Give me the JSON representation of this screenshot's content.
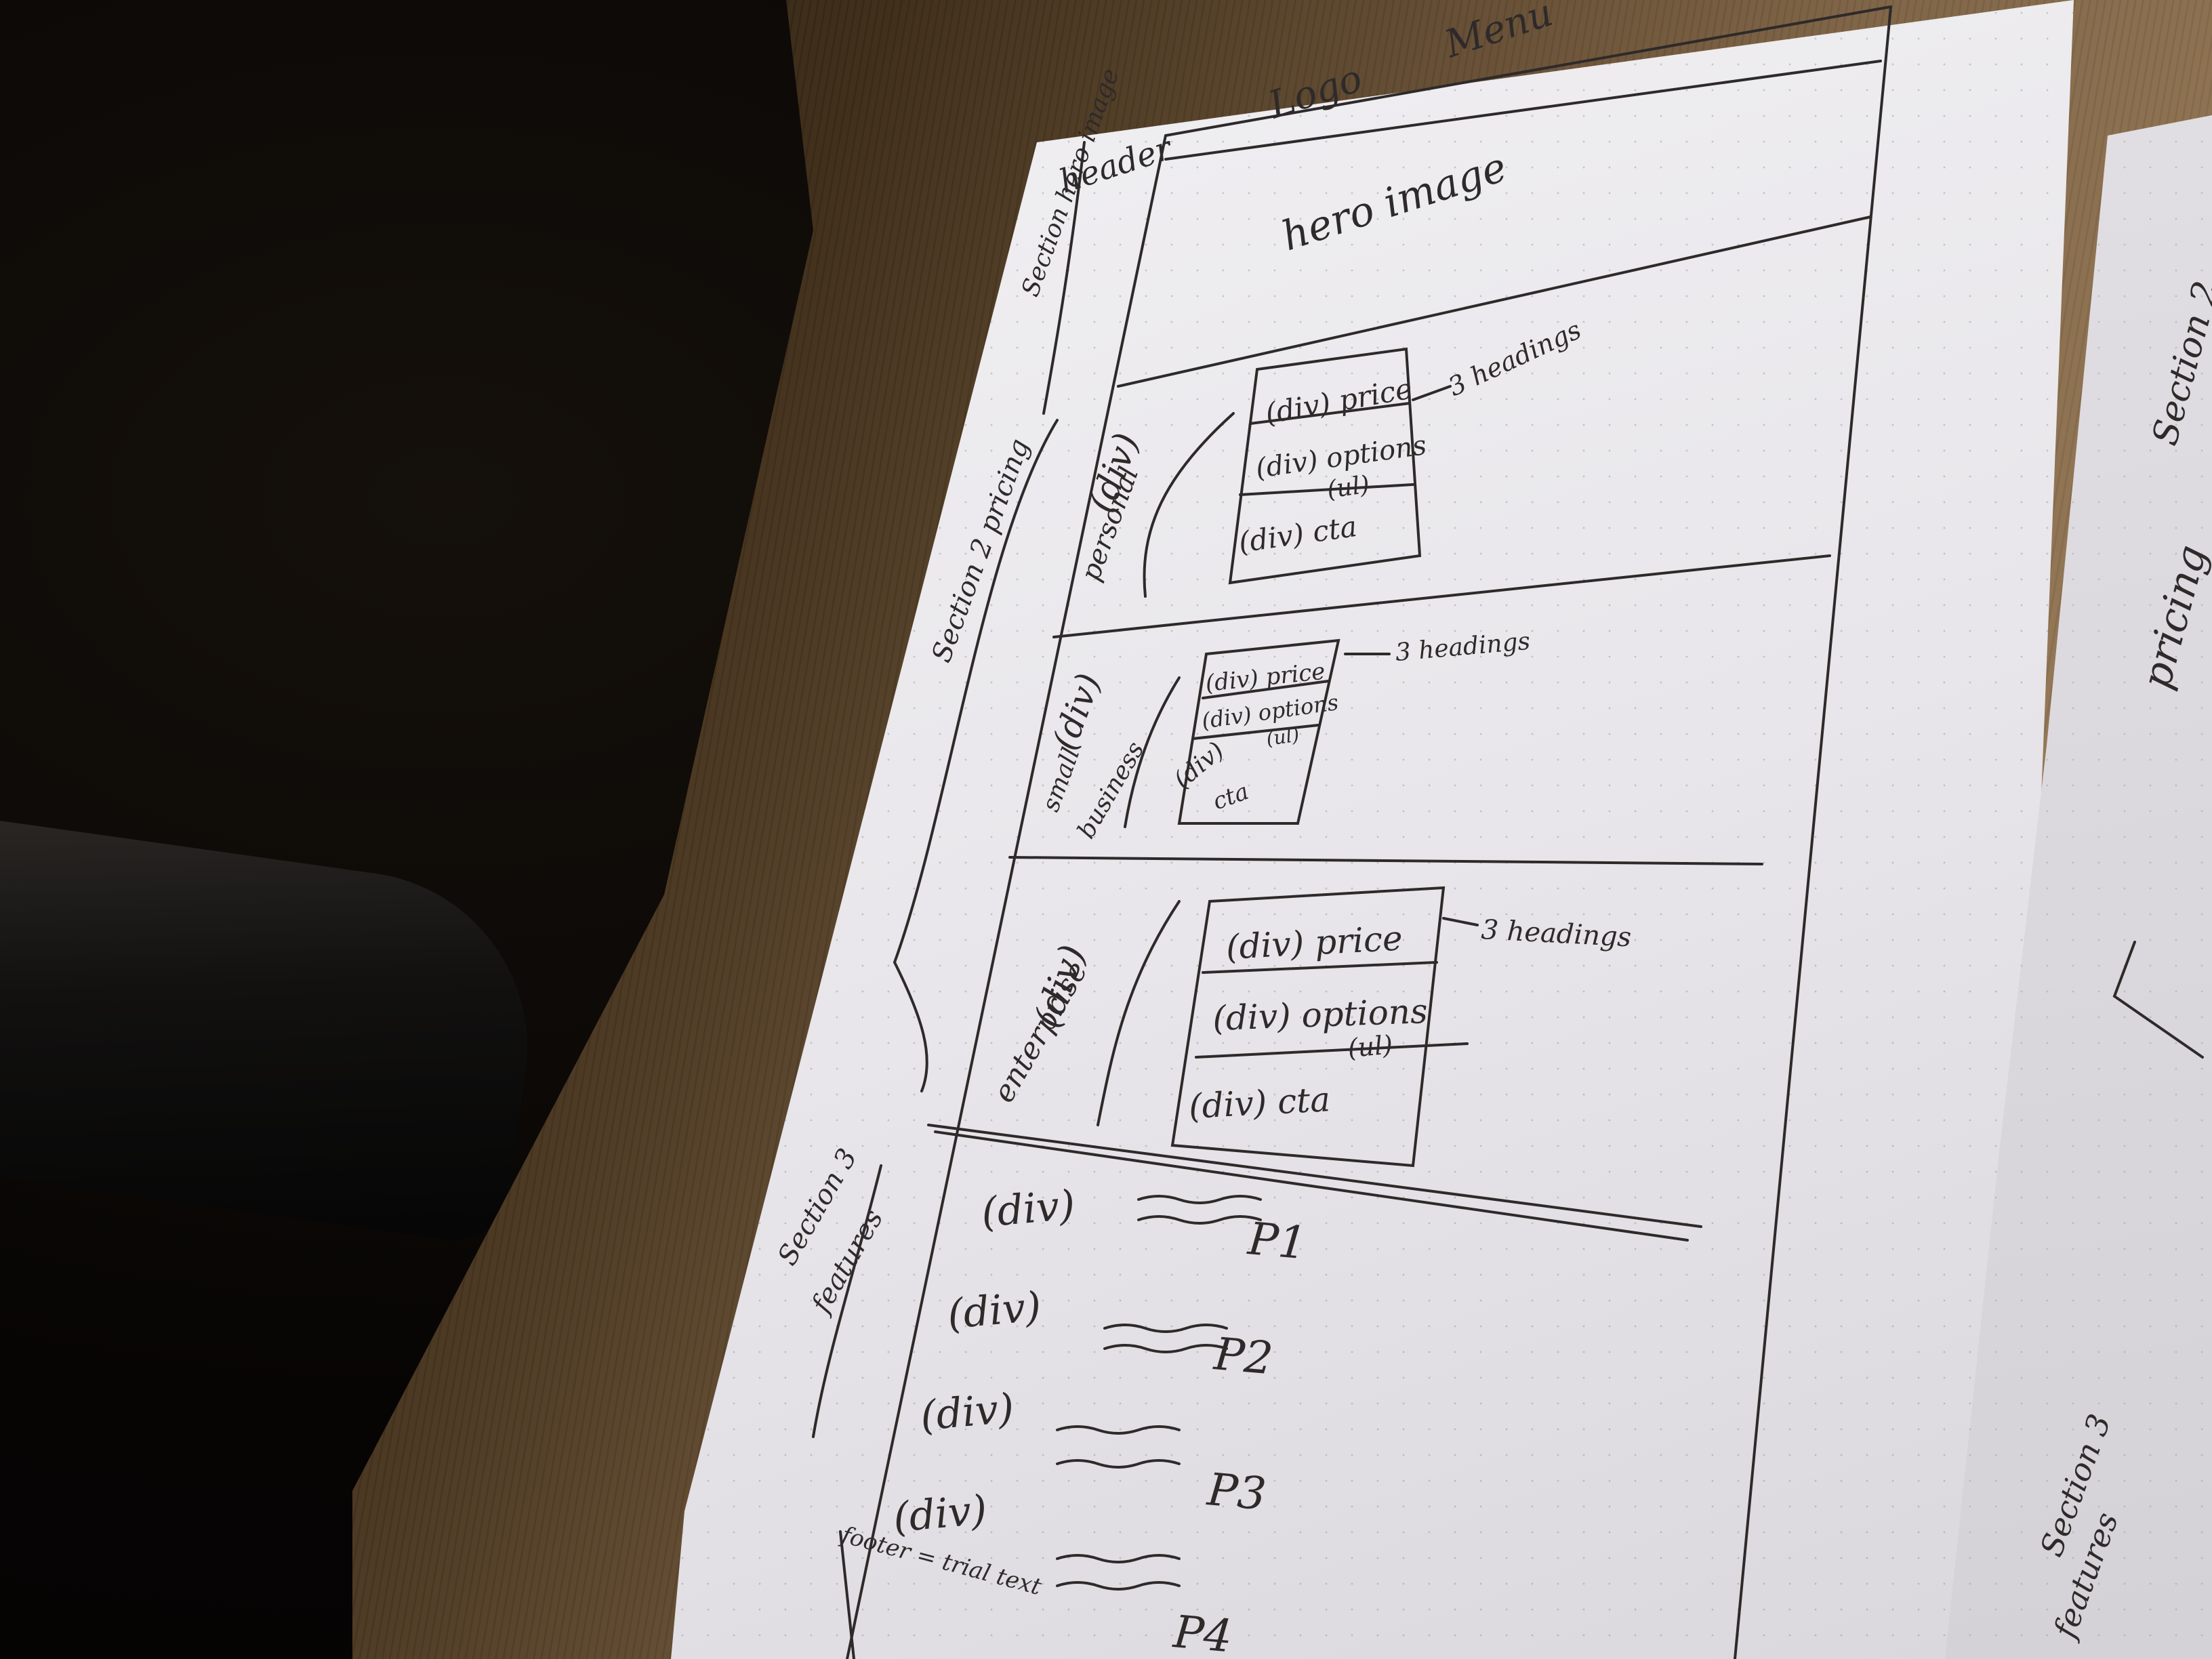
{
  "scene": {
    "description_kind": "photo",
    "ink_color": "#2e2a2a",
    "paper_color": "#ecebee",
    "table_color": "#7d6244"
  },
  "wireframe": {
    "header": "header",
    "logo": "Logo",
    "menu": "Menu",
    "hero_section_label": "Section hero image",
    "hero": "hero image",
    "pricing_section_label": "Section 2 pricing",
    "personal": {
      "div": "(div)",
      "name": "personal",
      "price": "(div) price",
      "options": "(div) options",
      "options_ul": "(ul)",
      "cta": "(div) cta",
      "note": "3 headings"
    },
    "small_business": {
      "div": "(div)",
      "name_1": "small",
      "name_2": "business",
      "price": "(div) price",
      "options": "(div) options",
      "options_ul": "(ul)",
      "cta_div": "(div)",
      "cta": "cta",
      "note": "3 headings"
    },
    "enterprise": {
      "div": "(div)",
      "name": "enterprise",
      "price": "(div) price",
      "options": "(div) options",
      "options_ul": "(ul)",
      "cta": "(div) cta",
      "note": "3 headings"
    },
    "features_section_label_1": "Section 3",
    "features_section_label_2": "features",
    "features": [
      {
        "div": "(div)",
        "p": "P1"
      },
      {
        "div": "(div)",
        "p": "P2"
      },
      {
        "div": "(div)",
        "p": "P3"
      },
      {
        "div": "(div)",
        "p": "P4"
      }
    ],
    "footer": "footer = trial text"
  },
  "second_page": {
    "section_2": "Section 2",
    "pricing": "pricing",
    "section_3": "Section 3",
    "features": "features"
  }
}
